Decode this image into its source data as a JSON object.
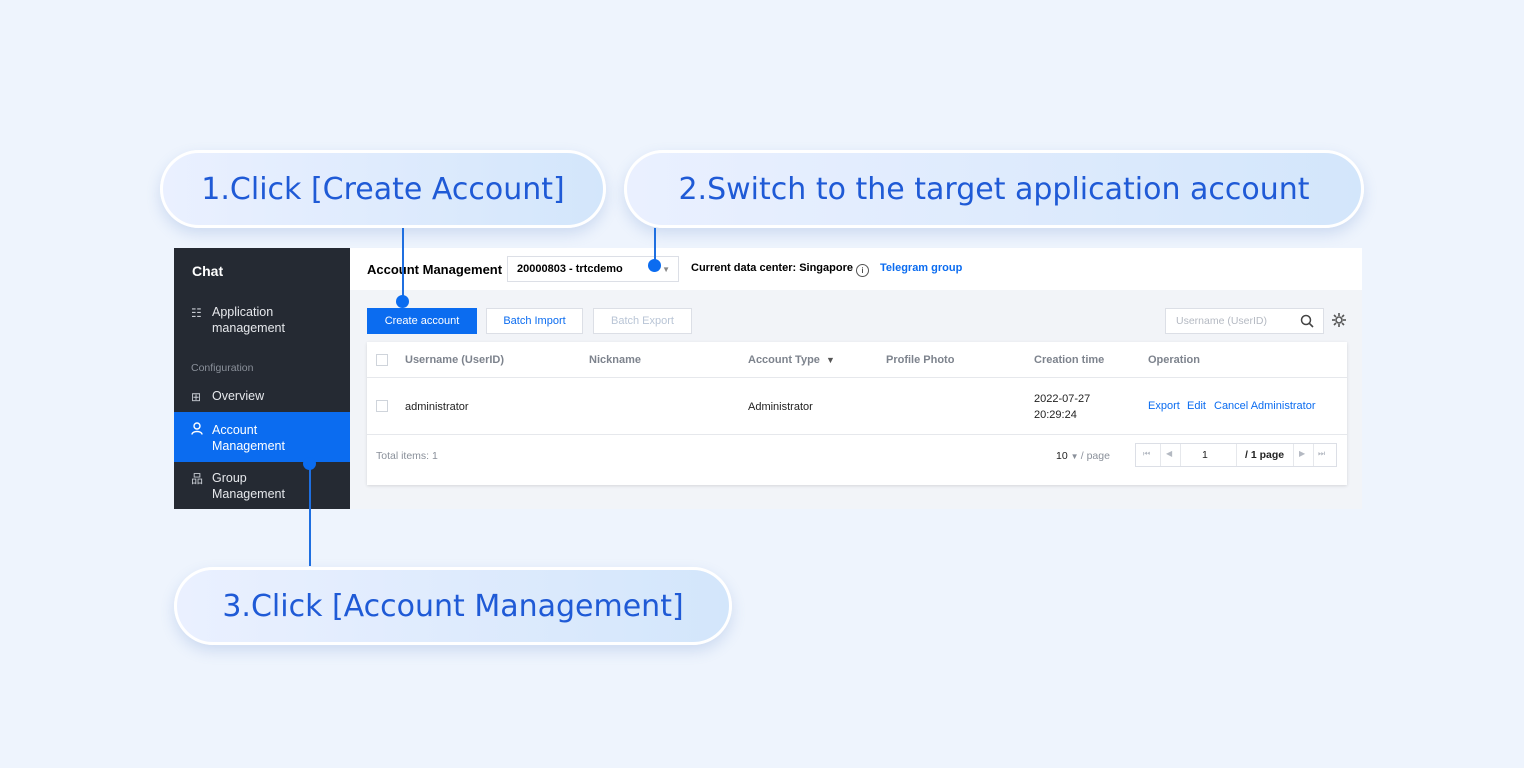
{
  "callouts": {
    "step1": "1.Click [Create Account]",
    "step2": "2.Switch to the target application account",
    "step3": "3.Click [Account Management]"
  },
  "sidebar": {
    "title": "Chat",
    "app_management": [
      "Application",
      "management"
    ],
    "section_label": "Configuration",
    "overview": "Overview",
    "account_management": [
      "Account",
      "Management"
    ],
    "group_management": [
      "Group",
      "Management"
    ],
    "active_item": "account_management"
  },
  "header": {
    "title": "Account Management",
    "app_select_value": "20000803 - trtcdemo",
    "data_center": "Current data center: Singapore",
    "telegram_link": "Telegram group"
  },
  "toolbar": {
    "create": "Create account",
    "batch_import": "Batch Import",
    "batch_export": "Batch Export",
    "search_placeholder": "Username (UserID)"
  },
  "table": {
    "columns": [
      "Username (UserID)",
      "Nickname",
      "Account Type",
      "Profile Photo",
      "Creation time",
      "Operation"
    ],
    "rows": [
      {
        "username": "administrator",
        "nickname": "",
        "account_type": "Administrator",
        "profile_photo": "",
        "creation_date": "2022-07-27",
        "creation_time": "20:29:24",
        "operations": [
          "Export",
          "Edit",
          "Cancel Administrator"
        ]
      }
    ],
    "footer": {
      "total": "Total items: 1",
      "page_size": "10",
      "per_page_label": "/ page",
      "current_page": "1",
      "page_count": "/ 1 page"
    }
  },
  "colors": {
    "accent": "#0b6cf0",
    "sidebar_bg": "#252a33",
    "callout_text": "#1f5ad6",
    "background": "#eef4fd"
  }
}
